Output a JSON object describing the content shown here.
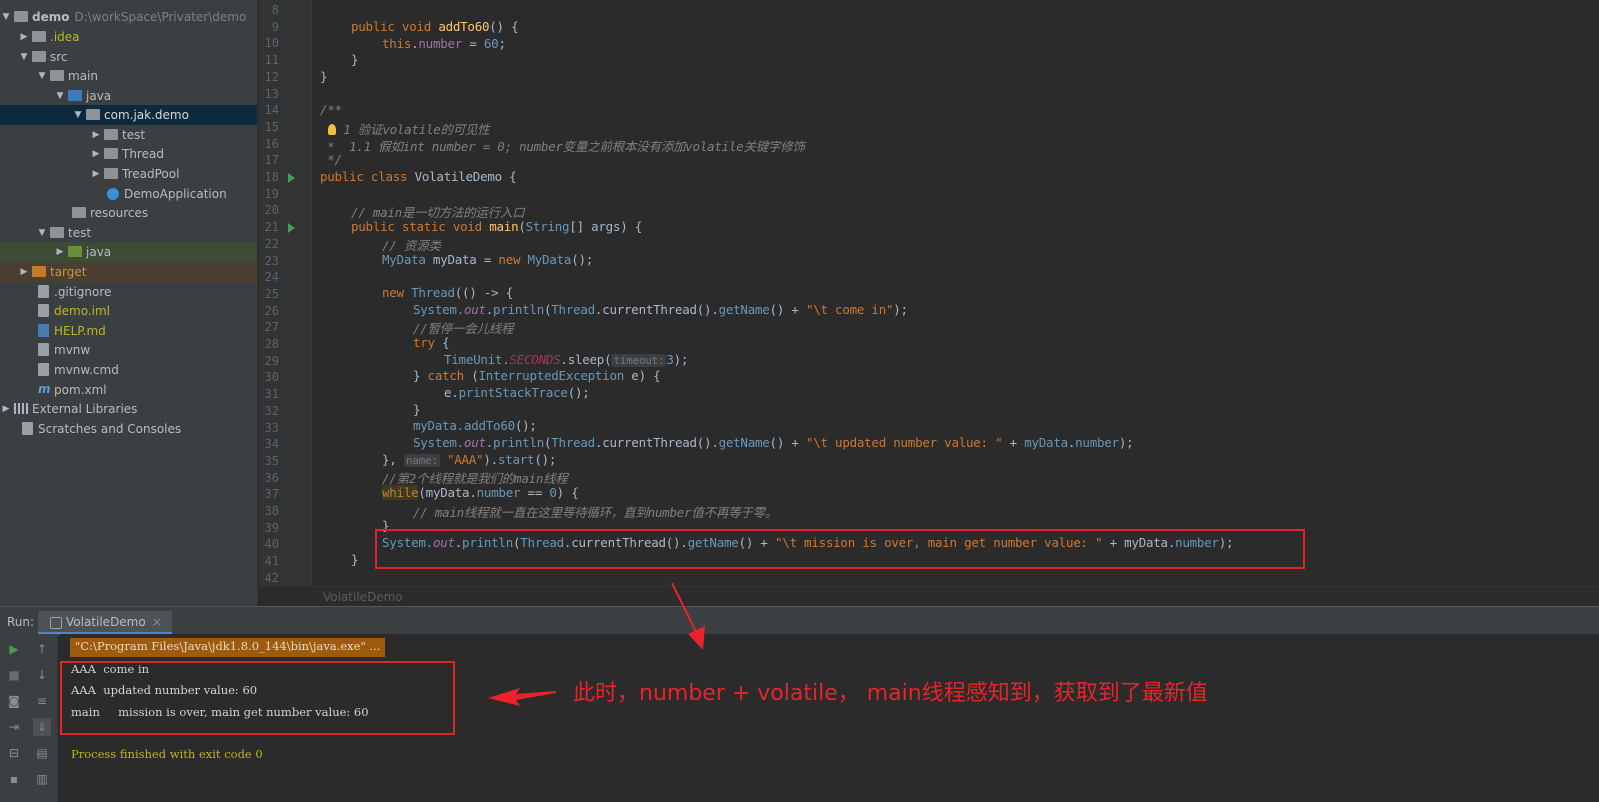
{
  "tree": {
    "root_name": "demo",
    "root_path": "D:\\workSpace\\Privater\\demo",
    "items": [
      {
        "label": ".idea",
        "icon": "folder-icon"
      },
      {
        "label": "src",
        "icon": "folder-icon"
      },
      {
        "label": "main",
        "icon": "folder-icon"
      },
      {
        "label": "java",
        "icon": "source-folder-icon"
      },
      {
        "label": "com.jak.demo",
        "icon": "package-icon"
      },
      {
        "label": "test",
        "icon": "package-icon"
      },
      {
        "label": "Thread",
        "icon": "package-icon"
      },
      {
        "label": "TreadPool",
        "icon": "package-icon"
      },
      {
        "label": "DemoApplication",
        "icon": "spring-class-icon"
      },
      {
        "label": "resources",
        "icon": "resources-folder-icon"
      },
      {
        "label": "test",
        "icon": "folder-icon"
      },
      {
        "label": "java",
        "icon": "test-source-folder-icon"
      },
      {
        "label": "target",
        "icon": "excluded-folder-icon"
      },
      {
        "label": ".gitignore",
        "icon": "file-icon"
      },
      {
        "label": "demo.iml",
        "icon": "iml-file-icon"
      },
      {
        "label": "HELP.md",
        "icon": "markdown-file-icon"
      },
      {
        "label": "mvnw",
        "icon": "script-file-icon"
      },
      {
        "label": "mvnw.cmd",
        "icon": "file-icon"
      },
      {
        "label": "pom.xml",
        "icon": "maven-icon"
      },
      {
        "label": "External Libraries",
        "icon": "library-icon"
      },
      {
        "label": "Scratches and Consoles",
        "icon": "scratches-icon"
      }
    ]
  },
  "editor": {
    "line_numbers": [
      "8",
      "9",
      "10",
      "11",
      "12",
      "13",
      "14",
      "15",
      "16",
      "17",
      "18",
      "19",
      "20",
      "21",
      "22",
      "23",
      "24",
      "25",
      "26",
      "27",
      "28",
      "29",
      "30",
      "31",
      "32",
      "33",
      "34",
      "35",
      "36",
      "37",
      "38",
      "39",
      "40",
      "41",
      "42"
    ],
    "lines": {
      "l9": [
        "public void ",
        "addTo60",
        "() {"
      ],
      "l10": [
        "this",
        ".",
        "number",
        " = ",
        "60",
        ";"
      ],
      "l11": "}",
      "l12": "}",
      "l14": "/**",
      "l15": "1 验证volatile的可见性",
      "l16": " *  1.1 假如int number = 0; number变量之前根本没有添加volatile关键字修饰",
      "l17": " */",
      "l18": [
        "public class ",
        "VolatileDemo",
        " {"
      ],
      "l20": "// main是一切方法的运行入口",
      "l21": [
        "public static void ",
        "main",
        "(",
        "String",
        "[] args) {"
      ],
      "l22": "// 资源类",
      "l23": [
        "MyData",
        " myData = ",
        "new ",
        "MyData",
        "();"
      ],
      "l25": [
        "new ",
        "Thread",
        "(() -> {"
      ],
      "l26": [
        "System.",
        "out",
        ".",
        "println",
        "(",
        "Thread",
        ".currentThread().",
        "getName",
        "() + ",
        "\"\\t come in\"",
        ");"
      ],
      "l27": "//暂停一会儿线程",
      "l28": [
        "try",
        " {"
      ],
      "l29": [
        "TimeUnit.",
        "SECONDS",
        ".sleep(",
        "timeout:",
        "3",
        ");"
      ],
      "l30": [
        "} ",
        "catch",
        " (",
        "InterruptedException",
        " e) {"
      ],
      "l31": [
        "e.",
        "printStackTrace",
        "();"
      ],
      "l32": "}",
      "l33": [
        "myData.",
        "addTo60",
        "();"
      ],
      "l34": [
        "System.",
        "out",
        ".",
        "println",
        "(",
        "Thread",
        ".currentThread().",
        "getName",
        "() + ",
        "\"\\t updated number value: \"",
        " + ",
        "myData",
        ".",
        "number",
        ");"
      ],
      "l35": [
        "}, ",
        "name:",
        " ",
        "\"AAA\"",
        ").",
        "start",
        "();"
      ],
      "l36": "//第2个线程就是我们的main线程",
      "l37": [
        "while",
        "(myData.",
        "number",
        " == ",
        "0",
        ") {"
      ],
      "l38": "// main线程就一直在这里等待循环，直到number值不再等于零。",
      "l39": "}",
      "l40": [
        "System.",
        "out",
        ".",
        "println",
        "(",
        "Thread",
        ".currentThread().",
        "getName",
        "() + ",
        "\"\\t mission is over, main get number value: \"",
        " + ",
        "myData.",
        "number",
        ");"
      ],
      "l41": "}"
    },
    "file_tab": "VolatileDemo"
  },
  "run": {
    "label": "Run:",
    "tab": "VolatileDemo",
    "close": "×",
    "cmd": "\"C:\\Program Files\\Java\\jdk1.8.0_144\\bin\\java.exe\" ...",
    "out1": "AAA  come in",
    "out2": "AAA  updated number value: 60",
    "out3": "main     mission is over, main get number value: 60",
    "finish": "Process finished with exit code 0"
  },
  "annotation": "此时，number + volatile， main线程感知到，获取到了最新值",
  "colors": {
    "annotation": "#e8242a",
    "box": "#e0242a",
    "keyword": "#cc7832",
    "string": "#6a8759"
  }
}
